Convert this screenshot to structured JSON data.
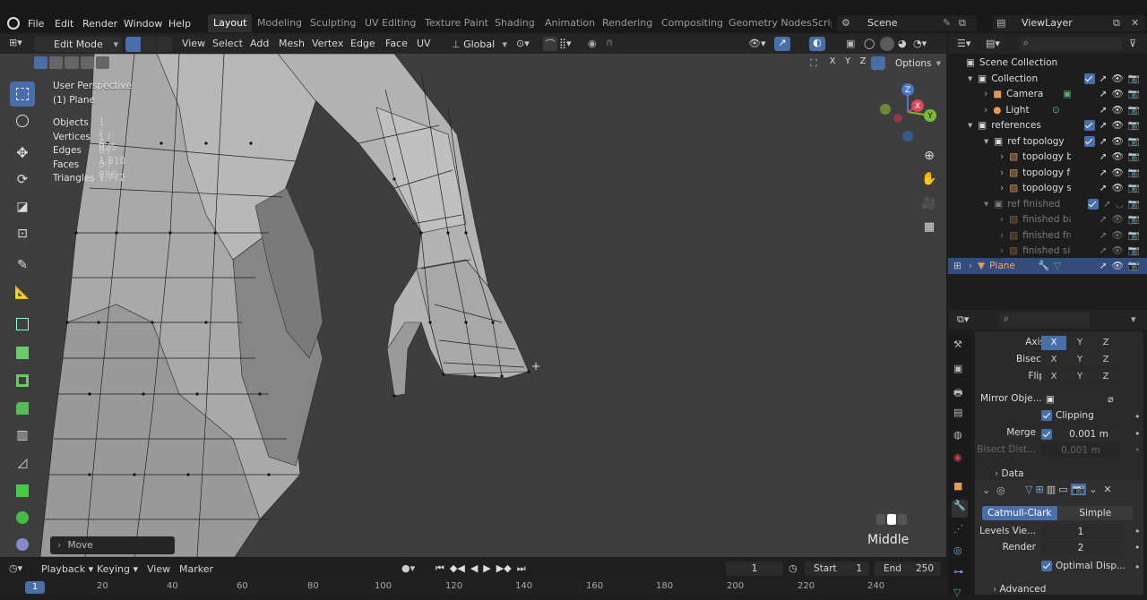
{
  "topbar": {
    "menus": [
      "File",
      "Edit",
      "Render",
      "Window",
      "Help"
    ],
    "workspaces": [
      "Layout",
      "Modeling",
      "Sculpting",
      "UV Editing",
      "Texture Paint",
      "Shading",
      "Animation",
      "Rendering",
      "Compositing",
      "Geometry Nodes",
      "Scrip"
    ],
    "scene": "Scene",
    "viewlayer": "ViewLayer"
  },
  "viewport_header": {
    "mode": "Edit Mode",
    "menus": [
      "View",
      "Select",
      "Add",
      "Mesh",
      "Vertex",
      "Edge",
      "Face",
      "UV"
    ],
    "orientation": "Global",
    "axes": [
      "X",
      "Y",
      "Z"
    ],
    "options": "Options"
  },
  "overlay": {
    "perspective": "User Perspective",
    "object": "(1) Plane",
    "stats": [
      {
        "label": "Objects",
        "value": "1 / 6"
      },
      {
        "label": "Vertices",
        "value": "1 / 925"
      },
      {
        "label": "Edges",
        "value": "0 / 1,810"
      },
      {
        "label": "Faces",
        "value": "0 / 886"
      },
      {
        "label": "Triangles",
        "value": "1,772"
      }
    ],
    "last_op": "Move",
    "view_label": "Middle"
  },
  "gizmo": {
    "z": "Z",
    "x": "X",
    "y": "Y"
  },
  "outliner": {
    "root": "Scene Collection",
    "rows": [
      {
        "label": "Collection",
        "depth": 0
      },
      {
        "label": "Camera",
        "depth": 1
      },
      {
        "label": "Light",
        "depth": 1
      },
      {
        "label": "references",
        "depth": 0
      },
      {
        "label": "ref topology",
        "depth": 1
      },
      {
        "label": "topology ba",
        "depth": 2
      },
      {
        "label": "topology fro",
        "depth": 2
      },
      {
        "label": "topology sid",
        "depth": 2
      },
      {
        "label": "ref finished",
        "depth": 1
      },
      {
        "label": "finished ba",
        "depth": 2
      },
      {
        "label": "finished fro",
        "depth": 2
      },
      {
        "label": "finished sid",
        "depth": 2
      },
      {
        "label": "Plane",
        "depth": 0
      }
    ]
  },
  "properties": {
    "axis_label": "Axis",
    "bisect_label": "Bisect",
    "flip_label": "Flip",
    "mirror_label": "Mirror Obje...",
    "clipping": "Clipping",
    "merge_label": "Merge",
    "merge_value": "0.001 m",
    "bisect_dist_label": "Bisect Dist...",
    "bisect_dist_value": "0.001 m",
    "data": "Data",
    "subsurf_catmull": "Catmull-Clark",
    "subsurf_simple": "Simple",
    "levels_label": "Levels Vie...",
    "levels_value": "1",
    "render_label": "Render",
    "render_value": "2",
    "optimal": "Optimal Disp...",
    "advanced": "Advanced"
  },
  "timeline": {
    "menus": [
      "Playback",
      "Keying",
      "View",
      "Marker"
    ],
    "current_frame": "1",
    "start_label": "Start",
    "start": "1",
    "end_label": "End",
    "end": "250",
    "ticks": [
      "1",
      "20",
      "40",
      "60",
      "80",
      "100",
      "120",
      "140",
      "160",
      "180",
      "200",
      "220",
      "240"
    ]
  },
  "colors": {
    "accent": "#4a6ea8",
    "selection": "#334c7c",
    "viewport": "#3e3e3e"
  }
}
